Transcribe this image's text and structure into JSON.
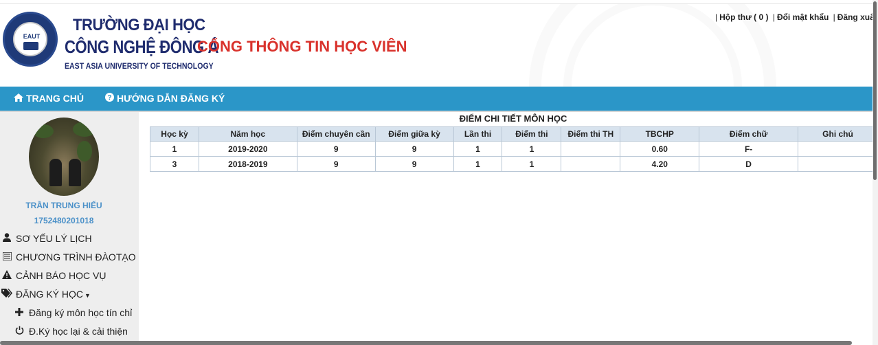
{
  "header": {
    "school_line1": "TRƯỜNG ĐẠI HỌC",
    "school_line2": "CÔNG NGHỆ ĐÔNG Á",
    "school_line3": "EAST ASIA UNIVERSITY OF TECHNOLOGY",
    "logo_text": "EAUT",
    "portal_title": "CỔNG THÔNG TIN HỌC VIÊN",
    "links": {
      "inbox": "Hộp thư ( 0 )",
      "change_password": "Đổi mật khẩu",
      "logout": "Đăng xuất",
      "separator": "|"
    }
  },
  "navbar": {
    "home": "TRANG CHỦ",
    "guide": "HƯỚNG DẪN ĐĂNG KÝ"
  },
  "sidebar": {
    "user_name": "TRẦN TRUNG HIẾU",
    "user_id": "1752480201018",
    "menu": [
      {
        "label": "SƠ YẾU LÝ LỊCH",
        "icon": "user-icon"
      },
      {
        "label": "CHƯƠNG TRÌNH ĐÀOTẠO",
        "icon": "list-icon"
      },
      {
        "label": "CẢNH BÁO HỌC VỤ",
        "icon": "warning-icon"
      },
      {
        "label": "ĐĂNG KÝ HỌC",
        "icon": "tags-icon"
      }
    ],
    "submenu": [
      {
        "label": "Đăng ký môn học tín chỉ",
        "icon": "plus-icon"
      },
      {
        "label": "Đ.Ký học lại & cải thiện",
        "icon": "power-icon"
      }
    ]
  },
  "main": {
    "section_title": "ĐIỂM CHI TIẾT MÔN HỌC",
    "columns": [
      "Học kỳ",
      "Năm học",
      "Điểm chuyên cần",
      "Điểm giữa kỳ",
      "Lần thi",
      "Điểm thi",
      "Điểm thi TH",
      "TBCHP",
      "Điểm chữ",
      "Ghi chú"
    ],
    "rows": [
      [
        "1",
        "2019-2020",
        "9",
        "9",
        "1",
        "1",
        "",
        "0.60",
        "F-",
        ""
      ],
      [
        "3",
        "2018-2019",
        "9",
        "9",
        "1",
        "1",
        "",
        "4.20",
        "D",
        ""
      ]
    ]
  },
  "colors": {
    "navbar": "#2b96c8",
    "portal_title": "#d9322c",
    "school_name": "#1f2c6e",
    "user_text": "#4a90c8",
    "table_header": "#d8e3ee"
  }
}
